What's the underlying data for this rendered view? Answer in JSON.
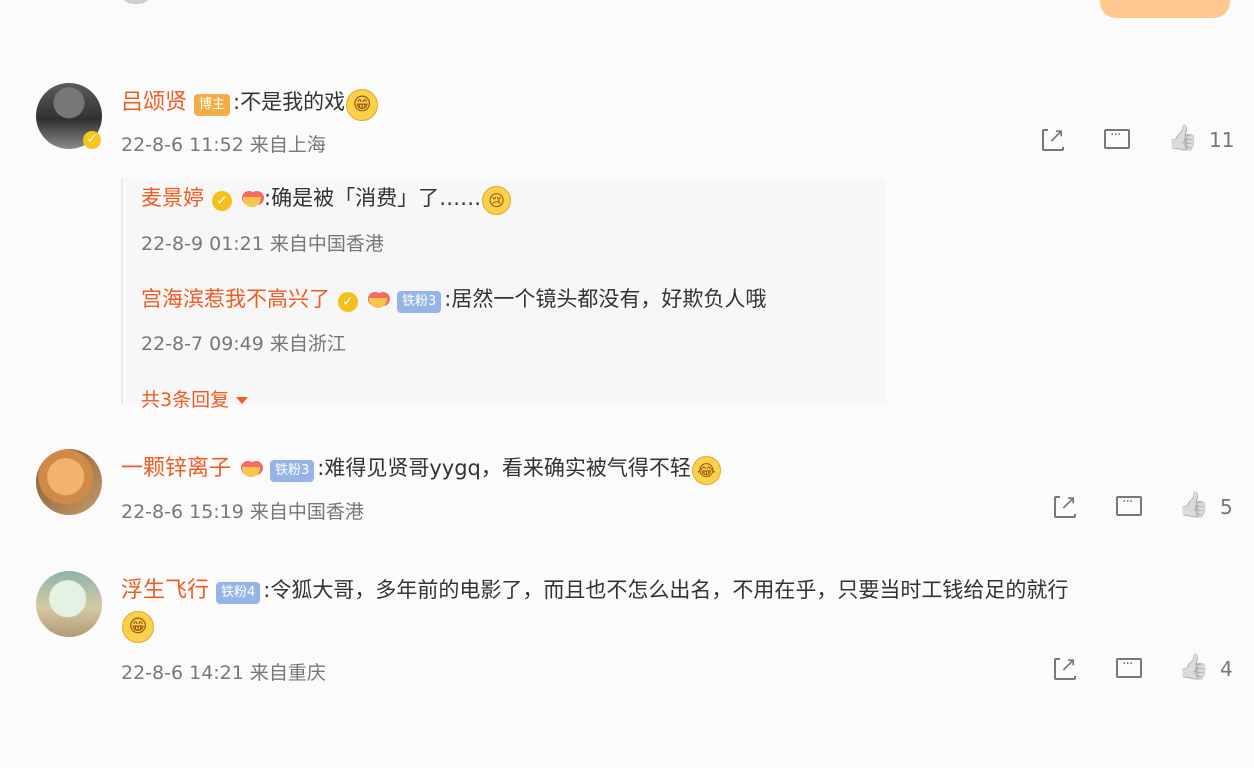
{
  "comments": [
    {
      "user": "吕颂贤",
      "badge": "博主",
      "text": ":不是我的戏",
      "emoji": "😁",
      "time": "22-8-6 11:52",
      "location": "来自上海",
      "likes": "11",
      "replies": [
        {
          "user": "麦景婷",
          "text": ":确是被「消费」了……",
          "emoji": "😢",
          "time": "22-8-9 01:21",
          "location": "来自中国香港"
        },
        {
          "user": "宫海滨惹我不高兴了",
          "badge": "铁粉3",
          "text": ":居然一个镜头都没有，好欺负人哦",
          "time": "22-8-7 09:49",
          "location": "来自浙江"
        }
      ],
      "more_replies": "共3条回复"
    },
    {
      "user": "一颗锌离子",
      "badge": "铁粉3",
      "text": ":难得见贤哥yygq，看来确实被气得不轻",
      "emoji": "😂",
      "time": "22-8-6 15:19",
      "location": "来自中国香港",
      "likes": "5"
    },
    {
      "user": "浮生飞行",
      "badge": "铁粉4",
      "text": ":令狐大哥，多年前的电影了，而且也不怎么出名，不用在乎，只要当时工钱给足的就行",
      "emoji": "😁",
      "time": "22-8-6 14:21",
      "location": "来自重庆",
      "likes": "4"
    }
  ],
  "bottom_partial_text": "",
  "colors": {
    "username": "#ef5b21",
    "text": "#333333",
    "meta": "#777777",
    "author_badge": "#f3ad44",
    "fan_badge": "#96b5e7"
  },
  "icons": {
    "share": "share-icon",
    "comment": "comment-icon",
    "like": "like-icon",
    "verified": "verified-icon"
  }
}
